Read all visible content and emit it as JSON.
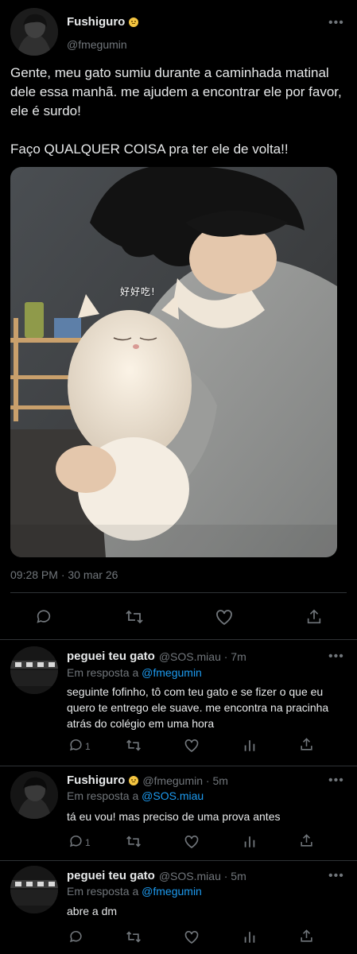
{
  "main_tweet": {
    "display_name": "Fushiguro",
    "handle": "@fmegumin",
    "more": "•••",
    "text_lines": [
      "Gente, meu gato sumiu durante a caminhada matinal dele essa manhã. me ajudem a encontrar ele por favor, ele é surdo!",
      "Faço QUALQUER COISA pra ter ele de volta!!"
    ],
    "image_sticker": "好好吃!",
    "timestamp": "09:28 PM · 30 mar 26",
    "actions": [
      "reply-icon",
      "retweet-icon",
      "like-icon",
      "share-icon"
    ]
  },
  "replies": [
    {
      "display_name": "peguei teu gato",
      "handle_time": "@SOS.miau · 7m",
      "reply_prefix": "Em resposta a ",
      "reply_to": "@fmegumin",
      "text": "seguinte fofinho, tô com teu gato e se fizer o que eu quero te entrego ele suave. me encontra na pracinha atrás do colégio em uma hora",
      "reply_count": "1",
      "more": "•••"
    },
    {
      "display_name": "Fushiguro",
      "handle_time": "@fmegumin · 5m",
      "reply_prefix": "Em resposta a ",
      "reply_to": "@SOS.miau",
      "text": "tá eu vou! mas preciso de uma prova antes",
      "reply_count": "1",
      "more": "•••"
    },
    {
      "display_name": "peguei teu gato",
      "handle_time": "@SOS.miau · 5m",
      "reply_prefix": "Em resposta a ",
      "reply_to": "@fmegumin",
      "text": "abre a dm",
      "reply_count": "",
      "more": "•••"
    }
  ],
  "colors": {
    "background": "#000000",
    "text": "#e7e9ea",
    "secondary": "#71767b",
    "link": "#1d9bf0",
    "divider": "#2f3336"
  }
}
